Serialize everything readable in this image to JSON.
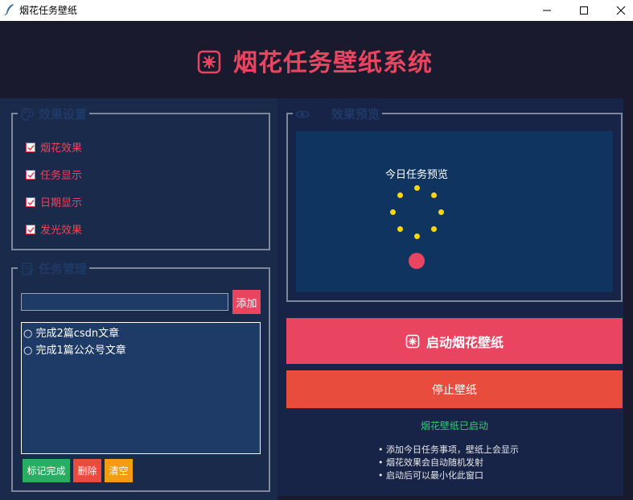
{
  "window": {
    "title": "烟花任务壁纸",
    "icon": "feather-icon",
    "controls": [
      "minimize-icon",
      "maximize-icon",
      "close-icon"
    ]
  },
  "header": {
    "icon": "firework-icon",
    "title": "烟花任务壁纸系统"
  },
  "effects_group": {
    "icon": "palette-icon",
    "title": "效果设置",
    "options": [
      {
        "label": "烟花效果",
        "checked": true
      },
      {
        "label": "任务显示",
        "checked": true
      },
      {
        "label": "日期显示",
        "checked": true
      },
      {
        "label": "发光效果",
        "checked": true
      }
    ]
  },
  "task_group": {
    "icon": "memo-icon",
    "title": "任务管理",
    "input_value": "",
    "add_label": "添加",
    "tasks": [
      "○ 完成2篇csdn文章",
      "○ 完成1篇公众号文章"
    ],
    "buttons": {
      "mark_done": "标记完成",
      "delete": "删除",
      "clear": "清空"
    }
  },
  "preview_group": {
    "icon": "eye-icon",
    "title": "效果预览",
    "preview_text": "今日任务预览"
  },
  "actions": {
    "start_icon": "firework-icon",
    "start_label": "启动烟花壁纸",
    "stop_label": "停止壁纸"
  },
  "status": "烟花壁纸已启动",
  "tips": [
    "• 添加今日任务事项，壁纸上会显示",
    "• 烟花效果会自动随机发射",
    "• 启动后可以最小化此窗口"
  ],
  "colors": {
    "accent": "#e94560",
    "bg": "#1a1a2e",
    "panel": "#0f3460",
    "success": "#2ecc71",
    "danger": "#e74c3c",
    "warning": "#f39c12",
    "confirm": "#27ae60",
    "firework_dot": "#ffd700"
  }
}
